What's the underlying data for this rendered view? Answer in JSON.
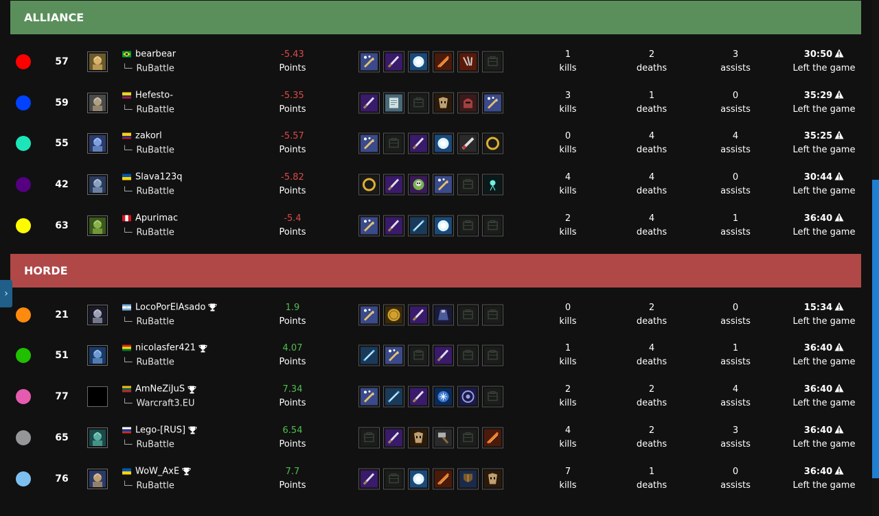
{
  "teams": [
    {
      "name": "ALLIANCE",
      "players": [
        {
          "color": "#ff0000",
          "level": "57",
          "hero": "paladin",
          "flag": "br",
          "name": "bearbear",
          "trophy": false,
          "server": "RuBattle",
          "points": "-5.43",
          "points_label": "Points",
          "points_sign": "neg",
          "items": [
            "staff",
            "dagger",
            "orb-white",
            "sword-fire",
            "claws",
            "empty"
          ],
          "kills": "1",
          "kills_label": "kills",
          "deaths": "2",
          "deaths_label": "deaths",
          "assists": "3",
          "assists_label": "assists",
          "time": "30:50",
          "status": "Left the game"
        },
        {
          "color": "#0042ff",
          "level": "59",
          "hero": "dwarf",
          "flag": "co",
          "name": "Hefesto-",
          "trophy": false,
          "server": "RuBattle",
          "points": "-5.35",
          "points_label": "Points",
          "points_sign": "neg",
          "items": [
            "dagger",
            "scroll",
            "empty",
            "mask",
            "helm",
            "staff"
          ],
          "kills": "3",
          "kills_label": "kills",
          "deaths": "1",
          "deaths_label": "deaths",
          "assists": "0",
          "assists_label": "assists",
          "time": "35:29",
          "status": "Left the game"
        },
        {
          "color": "#1ce6b9",
          "level": "55",
          "hero": "demon",
          "flag": "co",
          "name": "zakorl",
          "trophy": false,
          "server": "RuBattle",
          "points": "-5.57",
          "points_label": "Points",
          "points_sign": "neg",
          "items": [
            "staff",
            "empty",
            "dagger",
            "orb-white",
            "sword-red",
            "ring"
          ],
          "kills": "0",
          "kills_label": "kills",
          "deaths": "4",
          "deaths_label": "deaths",
          "assists": "4",
          "assists_label": "assists",
          "time": "35:25",
          "status": "Left the game"
        },
        {
          "color": "#540081",
          "level": "42",
          "hero": "elf",
          "flag": "ua",
          "name": "Slava123q",
          "trophy": false,
          "server": "RuBattle",
          "points": "-5.82",
          "points_label": "Points",
          "points_sign": "neg",
          "items": [
            "ring",
            "dagger",
            "skull",
            "staff",
            "empty",
            "wisp"
          ],
          "kills": "4",
          "kills_label": "kills",
          "deaths": "4",
          "deaths_label": "deaths",
          "assists": "0",
          "assists_label": "assists",
          "time": "30:44",
          "status": "Left the game"
        },
        {
          "color": "#fffc00",
          "level": "63",
          "hero": "orc",
          "flag": "pe",
          "name": "Apurimac",
          "trophy": false,
          "server": "RuBattle",
          "points": "-5.4",
          "points_label": "Points",
          "points_sign": "neg",
          "items": [
            "staff",
            "dagger",
            "blade-blue",
            "orb-white",
            "empty",
            "empty"
          ],
          "kills": "2",
          "kills_label": "kills",
          "deaths": "4",
          "deaths_label": "deaths",
          "assists": "1",
          "assists_label": "assists",
          "time": "36:40",
          "status": "Left the game"
        }
      ]
    },
    {
      "name": "HORDE",
      "players": [
        {
          "color": "#fe8a0e",
          "level": "21",
          "hero": "crypt",
          "flag": "ar",
          "name": "LocoPorElAsado",
          "trophy": true,
          "server": "RuBattle",
          "points": "1.9",
          "points_label": "Points",
          "points_sign": "pos",
          "items": [
            "staff",
            "coin",
            "dagger",
            "cloak",
            "empty",
            "empty"
          ],
          "kills": "0",
          "kills_label": "kills",
          "deaths": "2",
          "deaths_label": "deaths",
          "assists": "0",
          "assists_label": "assists",
          "time": "15:34",
          "status": "Left the game"
        },
        {
          "color": "#20c000",
          "level": "51",
          "hero": "dreadlord",
          "flag": "bo",
          "name": "nicolasfer421",
          "trophy": true,
          "server": "RuBattle",
          "points": "4.07",
          "points_label": "Points",
          "points_sign": "pos",
          "items": [
            "blade-blue",
            "staff",
            "empty",
            "dagger",
            "empty",
            "empty"
          ],
          "kills": "1",
          "kills_label": "kills",
          "deaths": "4",
          "deaths_label": "deaths",
          "assists": "1",
          "assists_label": "assists",
          "time": "36:40",
          "status": "Left the game"
        },
        {
          "color": "#e55bb0",
          "level": "77",
          "hero": "none",
          "flag": "lt",
          "name": "AmNeZiJuS",
          "trophy": true,
          "server": "Warcraft3.EU",
          "points": "7.34",
          "points_label": "Points",
          "points_sign": "pos",
          "items": [
            "staff",
            "blade-blue",
            "dagger",
            "rune",
            "rune2",
            "empty"
          ],
          "kills": "2",
          "kills_label": "kills",
          "deaths": "2",
          "deaths_label": "deaths",
          "assists": "4",
          "assists_label": "assists",
          "time": "36:40",
          "status": "Left the game"
        },
        {
          "color": "#959697",
          "level": "65",
          "hero": "troll",
          "flag": "ru",
          "name": "Lego-[RUS]",
          "trophy": true,
          "server": "RuBattle",
          "points": "6.54",
          "points_label": "Points",
          "points_sign": "pos",
          "items": [
            "empty",
            "dagger",
            "mask",
            "hammer",
            "empty",
            "sword-fire"
          ],
          "kills": "4",
          "kills_label": "kills",
          "deaths": "2",
          "deaths_label": "deaths",
          "assists": "3",
          "assists_label": "assists",
          "time": "36:40",
          "status": "Left the game"
        },
        {
          "color": "#7ebff1",
          "level": "76",
          "hero": "paladin2",
          "flag": "ua",
          "name": "WoW_AxE",
          "trophy": true,
          "server": "RuBattle",
          "points": "7.7",
          "points_label": "Points",
          "points_sign": "pos",
          "items": [
            "dagger",
            "empty",
            "orb-white",
            "sword-fire",
            "shield",
            "mask"
          ],
          "kills": "7",
          "kills_label": "kills",
          "deaths": "1",
          "deaths_label": "deaths",
          "assists": "0",
          "assists_label": "assists",
          "time": "36:40",
          "status": "Left the game"
        }
      ]
    }
  ]
}
